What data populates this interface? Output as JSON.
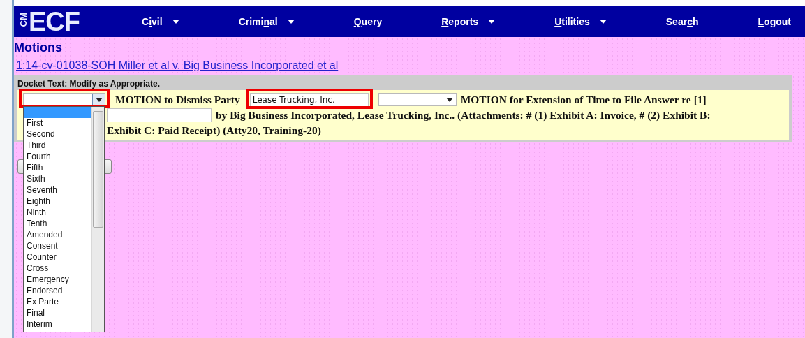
{
  "nav": {
    "logo": {
      "small": "CM",
      "big": "ECF"
    },
    "items": [
      {
        "before": "C",
        "key": "i",
        "after": "vil",
        "dropdown": true
      },
      {
        "before": "Crimi",
        "key": "n",
        "after": "al",
        "dropdown": true
      },
      {
        "key": "Q",
        "after": "uery",
        "dropdown": false
      },
      {
        "key": "R",
        "after": "eports",
        "dropdown": true
      },
      {
        "key": "U",
        "after": "tilities",
        "dropdown": true
      },
      {
        "before": "Sear",
        "key": "c",
        "after": "h",
        "dropdown": false
      },
      {
        "key": "L",
        "after": "ogout",
        "dropdown": false
      }
    ]
  },
  "page_title": "Motions",
  "case_link": "1:14-cv-01038-SOH Miller et al v. Big Business Incorporated et al",
  "docket": {
    "heading": "Docket Text: Modify as Appropriate.",
    "lines": [
      [
        {
          "kind": "select",
          "highlighted": true,
          "open": true,
          "options": [
            {
              "selected": true
            },
            {
              "label": "First",
              "selected": false
            },
            {
              "label": "Second",
              "selected": false
            },
            {
              "label": "Third",
              "selected": false
            },
            {
              "label": "Fourth",
              "selected": false
            },
            {
              "label": "Fifth",
              "selected": false
            },
            {
              "label": "Sixth",
              "selected": false
            },
            {
              "label": "Seventh",
              "selected": false
            },
            {
              "label": "Eighth",
              "selected": false
            },
            {
              "label": "Ninth",
              "selected": false
            },
            {
              "label": "Tenth",
              "selected": false
            },
            {
              "label": "Amended",
              "selected": false
            },
            {
              "label": "Consent",
              "selected": false
            },
            {
              "label": "Counter",
              "selected": false
            },
            {
              "label": "Cross",
              "selected": false
            },
            {
              "label": "Emergency",
              "selected": false
            },
            {
              "label": "Endorsed",
              "selected": false
            },
            {
              "label": "Ex Parte",
              "selected": false
            },
            {
              "label": "Final",
              "selected": false
            },
            {
              "label": "Interim",
              "selected": false
            }
          ]
        },
        {
          "kind": "text",
          "text": "MOTION to Dismiss Party"
        },
        {
          "kind": "input",
          "value": "Lease Trucking, Inc.",
          "highlighted": true
        },
        {
          "kind": "select",
          "highlighted": false,
          "open": false
        },
        {
          "kind": "text",
          "text": "MOTION for Extension of Time to File Answer re [1]"
        }
      ],
      [
        {
          "kind": "input",
          "highlighted": false
        },
        {
          "kind": "text",
          "text": "by Big Business Incorporated, Lease Trucking, Inc.. (Attachments: # (1) Exhibit A: Invoice, # (2) Exhibit B:"
        }
      ],
      [
        {
          "kind": "text",
          "text": "Exhibit C: Paid Receipt) (Atty20, Training-20)"
        }
      ]
    ]
  }
}
